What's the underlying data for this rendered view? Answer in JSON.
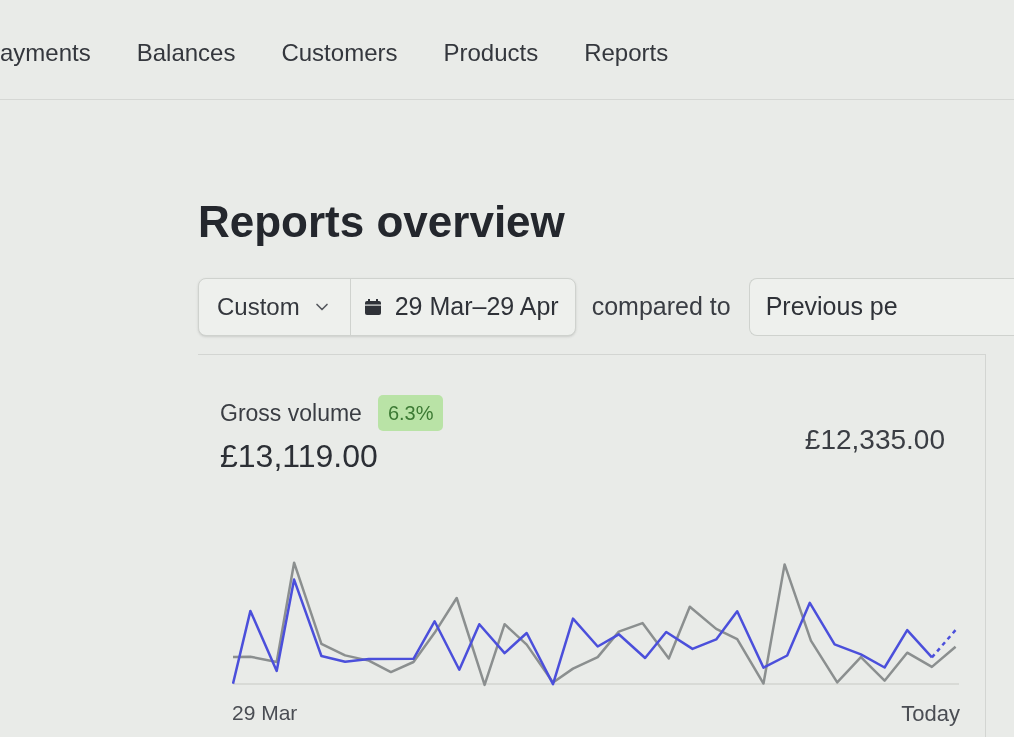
{
  "nav": [
    "ayments",
    "Balances",
    "Customers",
    "Products",
    "Reports"
  ],
  "page_title": "Reports overview",
  "filters": {
    "preset": "Custom",
    "date_range": "29 Mar–29 Apr",
    "compare_label": "compared to",
    "comparison": "Previous pe"
  },
  "metric": {
    "label": "Gross volume",
    "change": "6.3%",
    "value": "£13,119.00",
    "comparison_value": "£12,335.00",
    "chart": {
      "start_label": "29 Mar",
      "end_label": "Today"
    }
  }
}
